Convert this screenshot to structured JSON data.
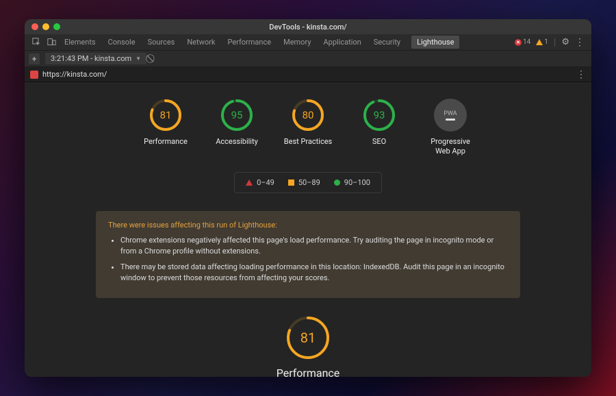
{
  "window": {
    "title": "DevTools - kinsta.com/"
  },
  "tabs": [
    "Elements",
    "Console",
    "Sources",
    "Network",
    "Performance",
    "Memory",
    "Application",
    "Security",
    "Lighthouse"
  ],
  "active_tab": "Lighthouse",
  "status": {
    "errors": 14,
    "warnings": 1
  },
  "report_tab": "3:21:43 PM - kinsta.com",
  "url": "https://kinsta.com/",
  "gauges": [
    {
      "label": "Performance",
      "value": 81,
      "color": "#f5a623"
    },
    {
      "label": "Accessibility",
      "value": 95,
      "color": "#2db04a"
    },
    {
      "label": "Best Practices",
      "value": 80,
      "color": "#f5a623"
    },
    {
      "label": "SEO",
      "value": 93,
      "color": "#2db04a"
    }
  ],
  "pwa_label": "Progressive Web App",
  "pwa_badge_text": "PWA",
  "legend": {
    "low": "0–49",
    "mid": "50–89",
    "high": "90–100"
  },
  "warning": {
    "title": "There were issues affecting this run of Lighthouse:",
    "items": [
      "Chrome extensions negatively affected this page's load performance. Try auditing the page in incognito mode or from a Chrome profile without extensions.",
      "There may be stored data affecting loading performance in this location: IndexedDB. Audit this page in an incognito window to prevent those resources from affecting your scores."
    ]
  },
  "detail": {
    "label": "Performance",
    "value": 81,
    "color": "#f5a623"
  }
}
